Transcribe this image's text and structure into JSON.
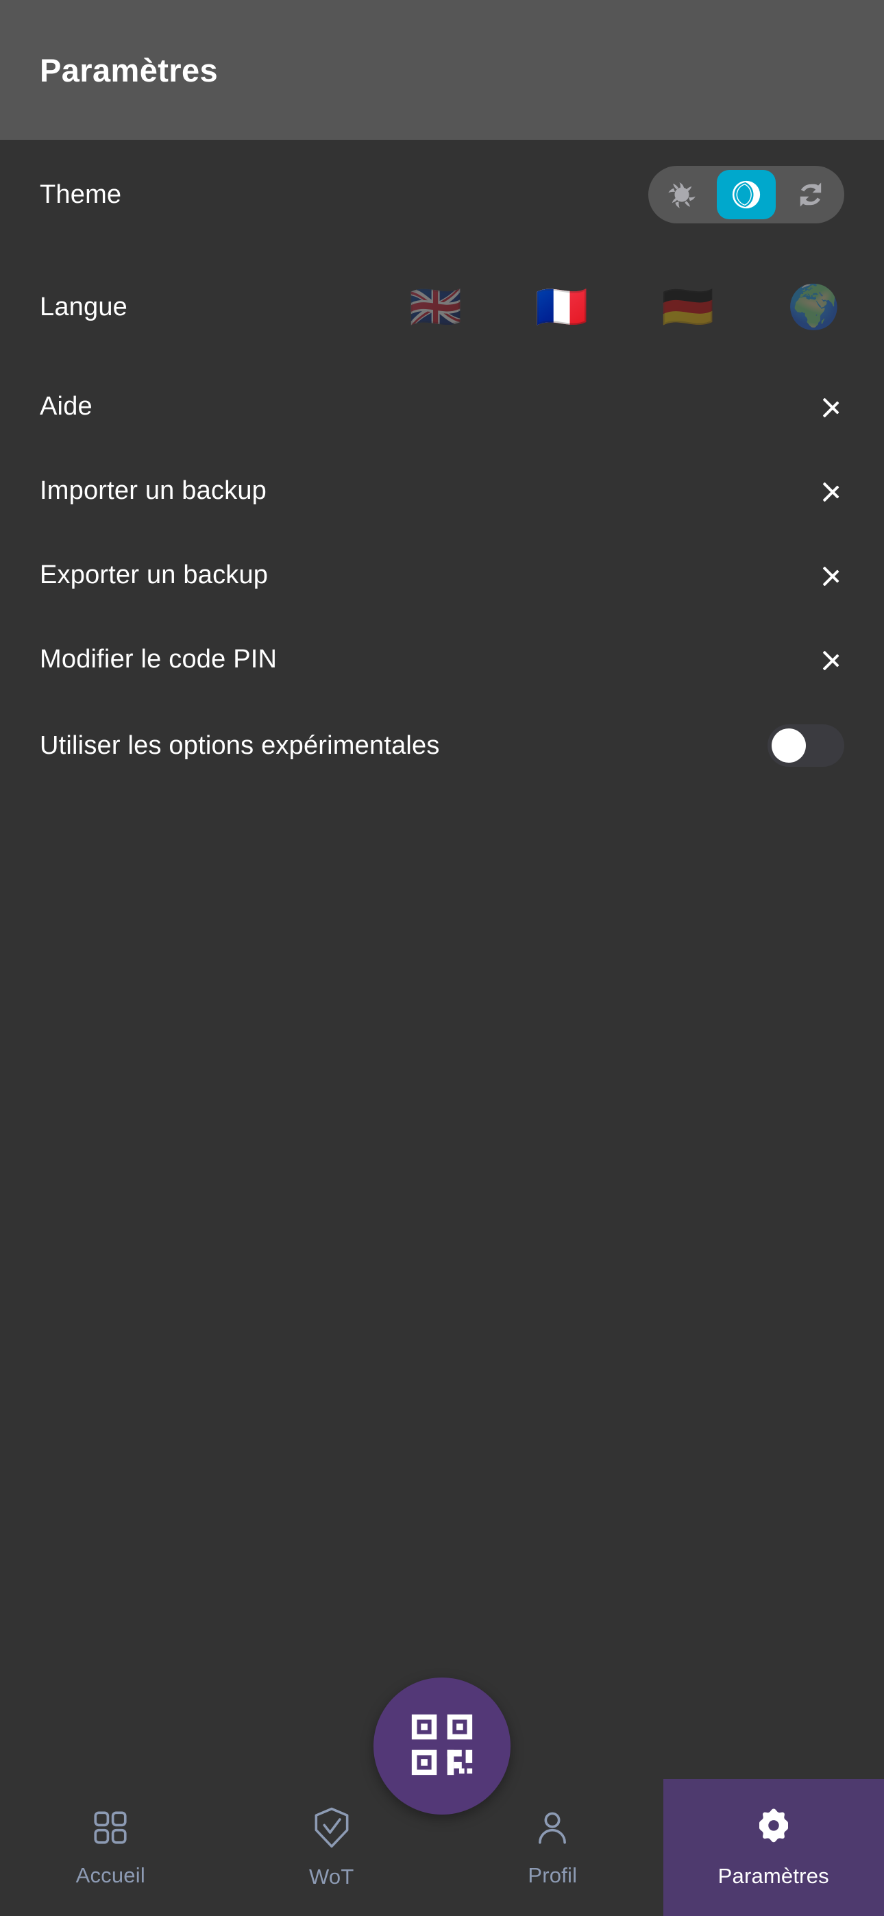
{
  "header": {
    "title": "Paramètres"
  },
  "settings": {
    "theme": {
      "label": "Theme",
      "options": [
        {
          "id": "light",
          "icon": "sun-icon",
          "selected": false
        },
        {
          "id": "dark",
          "icon": "moon-icon",
          "selected": true
        },
        {
          "id": "auto",
          "icon": "sync-icon",
          "selected": false
        }
      ],
      "selected_color": "#00a8cc"
    },
    "language": {
      "label": "Langue",
      "options": [
        {
          "id": "en",
          "flag": "🇬🇧",
          "icon": "flag-uk-icon",
          "selected": false
        },
        {
          "id": "fr",
          "flag": "🇫🇷",
          "icon": "flag-france-icon",
          "selected": true
        },
        {
          "id": "de",
          "flag": "🇩🇪",
          "icon": "flag-germany-icon",
          "selected": false
        },
        {
          "id": "system",
          "flag": "🌍",
          "icon": "globe-icon",
          "selected": false
        }
      ]
    },
    "links": [
      {
        "id": "help",
        "label": "Aide",
        "icon": "chevron-right-icon"
      },
      {
        "id": "import_backup",
        "label": "Importer un backup",
        "icon": "chevron-right-icon"
      },
      {
        "id": "export_backup",
        "label": "Exporter un backup",
        "icon": "chevron-right-icon"
      },
      {
        "id": "change_pin",
        "label": "Modifier le code PIN",
        "icon": "chevron-right-icon"
      }
    ],
    "experimental": {
      "label": "Utiliser les options expérimentales",
      "enabled": false
    }
  },
  "fab": {
    "icon": "qr-code-icon",
    "color": "#533877"
  },
  "bottom_nav": {
    "active_color": "#4e3a6e",
    "inactive_color": "#8d9bb4",
    "items": [
      {
        "id": "home",
        "label": "Accueil",
        "icon": "grid-icon",
        "active": false
      },
      {
        "id": "wot",
        "label": "WoT",
        "icon": "shield-check-icon",
        "active": false
      },
      {
        "id": "profile",
        "label": "Profil",
        "icon": "person-icon",
        "active": false
      },
      {
        "id": "settings",
        "label": "Paramètres",
        "icon": "gear-icon",
        "active": true
      }
    ]
  }
}
